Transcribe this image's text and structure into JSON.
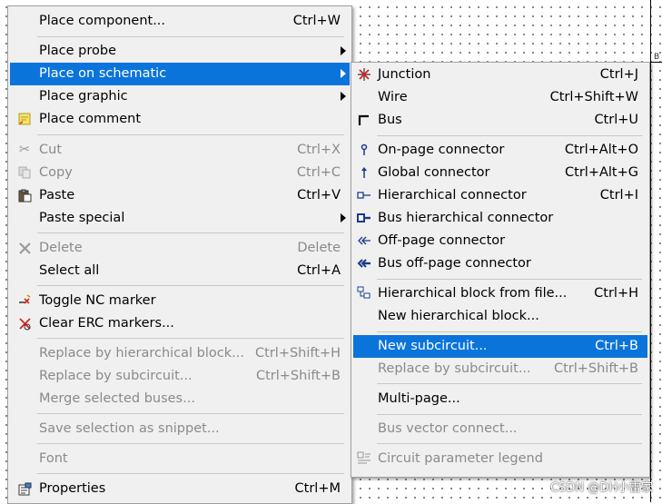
{
  "main_menu": {
    "items": [
      {
        "label": "Place component...",
        "shortcut": "Ctrl+W",
        "submenu": false,
        "disabled": false,
        "icon": ""
      },
      {
        "label": "Place probe",
        "shortcut": "",
        "submenu": true,
        "disabled": false,
        "icon": ""
      },
      {
        "label": "Place on schematic",
        "shortcut": "",
        "submenu": true,
        "disabled": false,
        "icon": "",
        "highlighted": true
      },
      {
        "label": "Place graphic",
        "shortcut": "",
        "submenu": true,
        "disabled": false,
        "icon": ""
      },
      {
        "label": "Place comment",
        "shortcut": "",
        "submenu": false,
        "disabled": false,
        "icon": "comment-icon"
      },
      {
        "label": "Cut",
        "shortcut": "Ctrl+X",
        "submenu": false,
        "disabled": true,
        "icon": "scissors-icon"
      },
      {
        "label": "Copy",
        "shortcut": "Ctrl+C",
        "submenu": false,
        "disabled": true,
        "icon": "copy-icon"
      },
      {
        "label": "Paste",
        "shortcut": "Ctrl+V",
        "submenu": false,
        "disabled": false,
        "icon": "paste-icon"
      },
      {
        "label": "Paste special",
        "shortcut": "",
        "submenu": true,
        "disabled": false,
        "icon": ""
      },
      {
        "label": "Delete",
        "shortcut": "Delete",
        "submenu": false,
        "disabled": true,
        "icon": "delete-x-icon"
      },
      {
        "label": "Select all",
        "shortcut": "Ctrl+A",
        "submenu": false,
        "disabled": false,
        "icon": ""
      },
      {
        "label": "Toggle NC marker",
        "shortcut": "",
        "submenu": false,
        "disabled": false,
        "icon": "nc-marker-icon"
      },
      {
        "label": "Clear ERC markers...",
        "shortcut": "",
        "submenu": false,
        "disabled": false,
        "icon": "erc-marker-icon"
      },
      {
        "label": "Replace by hierarchical block...",
        "shortcut": "Ctrl+Shift+H",
        "submenu": false,
        "disabled": true,
        "icon": ""
      },
      {
        "label": "Replace by subcircuit...",
        "shortcut": "Ctrl+Shift+B",
        "submenu": false,
        "disabled": true,
        "icon": ""
      },
      {
        "label": "Merge selected buses...",
        "shortcut": "",
        "submenu": false,
        "disabled": true,
        "icon": ""
      },
      {
        "label": "Save selection as snippet...",
        "shortcut": "",
        "submenu": false,
        "disabled": true,
        "icon": ""
      },
      {
        "label": "Font",
        "shortcut": "",
        "submenu": false,
        "disabled": true,
        "icon": ""
      },
      {
        "label": "Properties",
        "shortcut": "Ctrl+M",
        "submenu": false,
        "disabled": false,
        "icon": "properties-icon"
      }
    ]
  },
  "sub_menu": {
    "items": [
      {
        "label": "Junction",
        "shortcut": "Ctrl+J",
        "disabled": false,
        "icon": "junction-icon"
      },
      {
        "label": "Wire",
        "shortcut": "Ctrl+Shift+W",
        "disabled": false,
        "icon": ""
      },
      {
        "label": "Bus",
        "shortcut": "Ctrl+U",
        "disabled": false,
        "icon": "bus-icon"
      },
      {
        "label": "On-page connector",
        "shortcut": "Ctrl+Alt+O",
        "disabled": false,
        "icon": "on-page-connector-icon"
      },
      {
        "label": "Global connector",
        "shortcut": "Ctrl+Alt+G",
        "disabled": false,
        "icon": "global-connector-icon"
      },
      {
        "label": "Hierarchical connector",
        "shortcut": "Ctrl+I",
        "disabled": false,
        "icon": "hierarchical-connector-icon"
      },
      {
        "label": "Bus hierarchical connector",
        "shortcut": "",
        "disabled": false,
        "icon": "bus-hierarchical-connector-icon"
      },
      {
        "label": "Off-page connector",
        "shortcut": "",
        "disabled": false,
        "icon": "off-page-connector-icon"
      },
      {
        "label": "Bus off-page connector",
        "shortcut": "",
        "disabled": false,
        "icon": "bus-off-page-connector-icon"
      },
      {
        "label": "Hierarchical block from file...",
        "shortcut": "Ctrl+H",
        "disabled": false,
        "icon": "hierarchical-block-icon"
      },
      {
        "label": "New hierarchical block...",
        "shortcut": "",
        "disabled": false,
        "icon": ""
      },
      {
        "label": "New subcircuit...",
        "shortcut": "Ctrl+B",
        "disabled": false,
        "icon": "",
        "highlighted": true
      },
      {
        "label": "Replace by subcircuit...",
        "shortcut": "Ctrl+Shift+B",
        "disabled": true,
        "icon": ""
      },
      {
        "label": "Multi-page...",
        "shortcut": "",
        "disabled": false,
        "icon": ""
      },
      {
        "label": "Bus vector connect...",
        "shortcut": "",
        "disabled": true,
        "icon": ""
      },
      {
        "label": "Circuit parameter legend",
        "shortcut": "",
        "disabled": true,
        "icon": "parameter-legend-icon"
      }
    ]
  },
  "canvas": {
    "corner_label": "B"
  },
  "watermark": "CSDN @DH小雷家",
  "colors": {
    "highlight": "#0a74da",
    "menu_bg": "#f0f0f0",
    "disabled_text": "#8a8a8a"
  }
}
